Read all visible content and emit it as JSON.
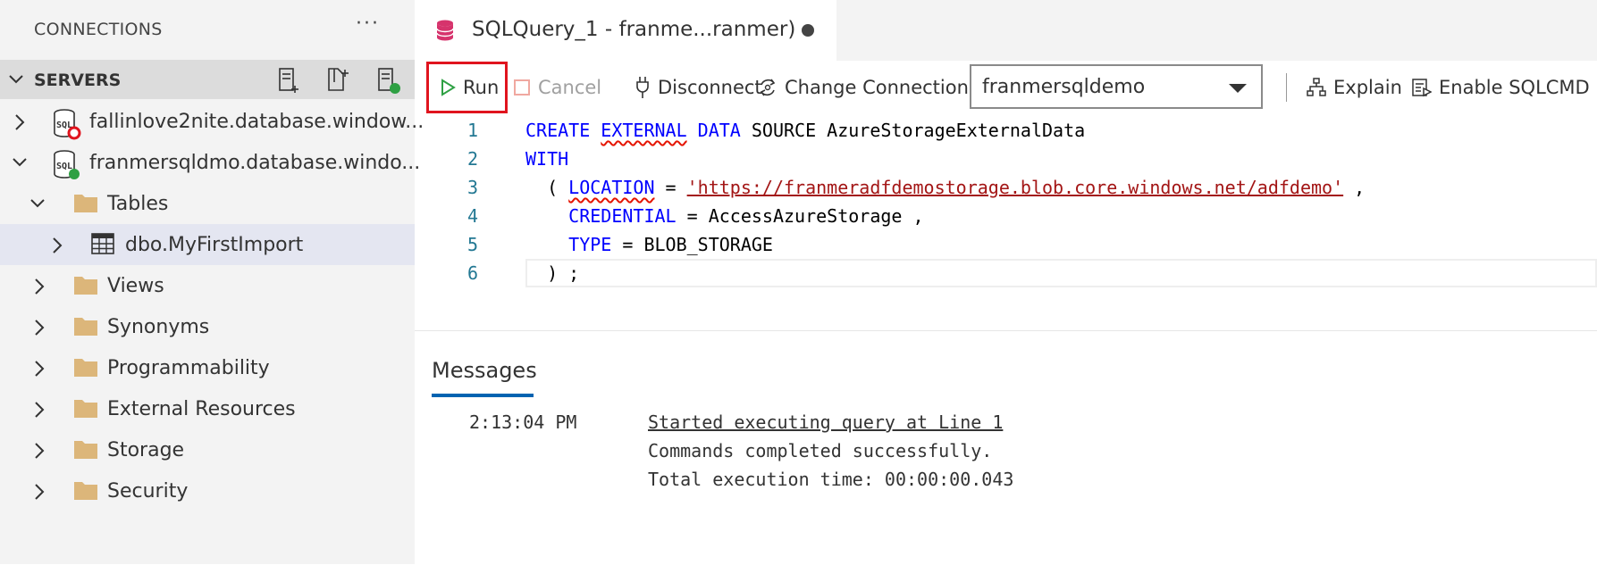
{
  "sidebar": {
    "title": "CONNECTIONS",
    "more": "···",
    "servers_title": "SERVERS",
    "tree": [
      {
        "label": "fallinlove2nite.database.window...",
        "status": "disconnected"
      },
      {
        "label": "franmersqldmo.database.windo...",
        "status": "connected"
      },
      {
        "label": "Tables"
      },
      {
        "label": "dbo.MyFirstImport",
        "selected": true
      },
      {
        "label": "Views"
      },
      {
        "label": "Synonyms"
      },
      {
        "label": "Programmability"
      },
      {
        "label": "External Resources"
      },
      {
        "label": "Storage"
      },
      {
        "label": "Security"
      }
    ]
  },
  "tab": {
    "title": "SQLQuery_1 - franme...ranmer)",
    "dirty": true
  },
  "toolbar": {
    "run": "Run",
    "cancel": "Cancel",
    "disconnect": "Disconnect",
    "change_connection": "Change Connection",
    "database": "franmersqldemo",
    "explain": "Explain",
    "enable_sqlcmd": "Enable SQLCMD"
  },
  "editor": {
    "line_numbers": [
      "1",
      "2",
      "3",
      "4",
      "5",
      "6"
    ],
    "lines": {
      "l1": {
        "kw1": "CREATE",
        "kw2": "EXTERNAL",
        "kw3": "DATA",
        "rest": " SOURCE AzureStorageExternalData"
      },
      "l2": {
        "kw1": "WITH"
      },
      "l3": {
        "pre": "  ( ",
        "kw1": "LOCATION",
        "mid": " = ",
        "str": "'https://franmeradfdemostorage.blob.core.windows.net/adfdemo'",
        "post": " ,"
      },
      "l4": {
        "pre": "    ",
        "kw1": "CREDENTIAL",
        "rest": " = AccessAzureStorage ,"
      },
      "l5": {
        "pre": "    ",
        "kw1": "TYPE",
        "rest": " = BLOB_STORAGE"
      },
      "l6": {
        "pre": "  ) ;"
      }
    }
  },
  "messages": {
    "tab_label": "Messages",
    "time": "2:13:04 PM",
    "line1": "Started executing query at Line 1",
    "line2": "Commands completed successfully.",
    "line3": "Total execution time: 00:00:00.043"
  },
  "colors": {
    "run_highlight": "#e0141e",
    "connected": "#2ea043",
    "disconnected": "#e0141e",
    "folder": "#dcb67a",
    "keyword": "#0000ff",
    "string": "#a31515",
    "line_number": "#237893"
  }
}
